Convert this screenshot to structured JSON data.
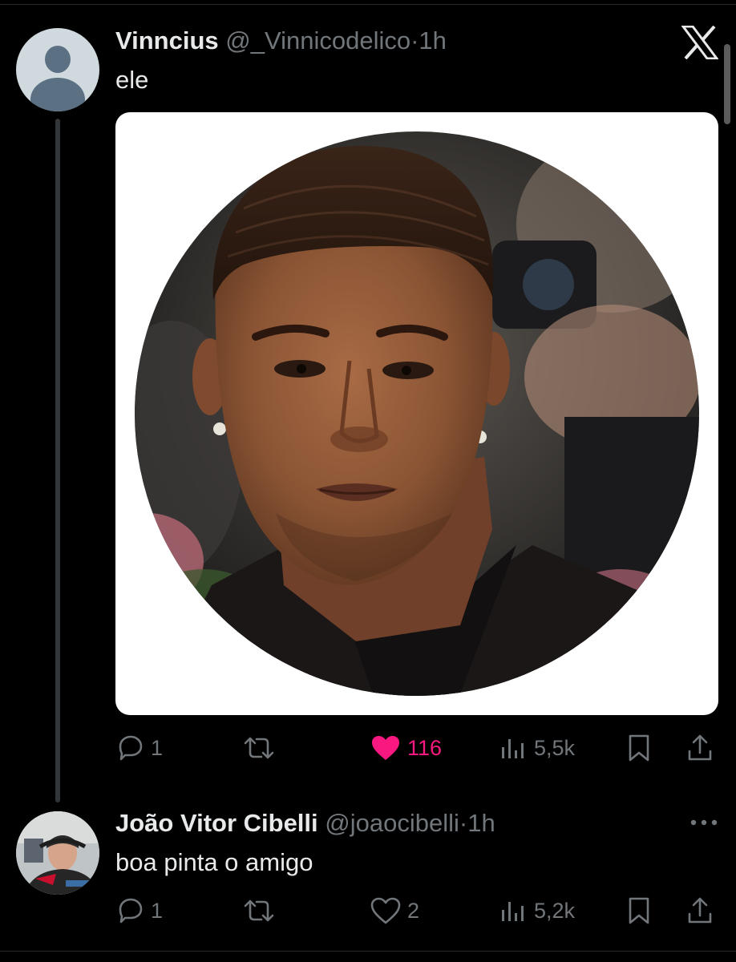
{
  "tweets": [
    {
      "author_name": "Vinncius",
      "author_handle": "@_Vinnicodelico",
      "separator": "·",
      "time": "1h",
      "text": "ele",
      "avatar": "default-avatar-icon",
      "media": "portrait-photo-circle-crop",
      "actions": {
        "replies": "1",
        "reposts": "",
        "likes": "116",
        "liked": true,
        "views": "5,5k"
      }
    },
    {
      "author_name": "João Vitor Cibelli",
      "author_handle": "@joaocibelli",
      "separator": "·",
      "time": "1h",
      "text": "boa pinta o amigo",
      "avatar": "user-photo-avatar",
      "actions": {
        "replies": "1",
        "reposts": "",
        "likes": "2",
        "liked": false,
        "views": "5,2k"
      }
    }
  ],
  "icons": {
    "brand": "x-logo-icon",
    "reply": "reply-icon",
    "repost": "repost-icon",
    "like": "heart-icon",
    "views": "views-icon",
    "bookmark": "bookmark-icon",
    "share": "share-icon",
    "more": "more-options-icon"
  },
  "colors": {
    "background": "#000000",
    "text": "#e7e9ea",
    "muted": "#71767b",
    "like_active": "#f91880",
    "thread_line": "#333639"
  }
}
